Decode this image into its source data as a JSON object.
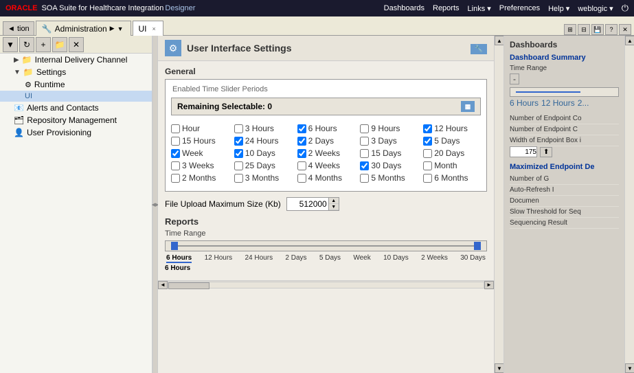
{
  "app": {
    "oracle_label": "ORACLE",
    "product_title": "SOA Suite for Healthcare Integration",
    "designer_label": "Designer"
  },
  "top_nav": {
    "items": [
      "Dashboards",
      "Reports",
      "Links ▾",
      "Preferences",
      "Help ▾",
      "weblogic ▾"
    ]
  },
  "tabs": {
    "back_label": "◄ tion",
    "admin_tab": {
      "label": "Administration",
      "icon": "🔧"
    },
    "ui_tab": {
      "label": "UI",
      "close": "×"
    }
  },
  "toolbar": {
    "buttons": [
      "▼",
      "☰",
      "+",
      "📁",
      "✕"
    ]
  },
  "sidebar": {
    "items": [
      {
        "label": "Internal Delivery Channel",
        "indent": 1,
        "type": "folder",
        "expanded": false
      },
      {
        "label": "Settings",
        "indent": 1,
        "type": "folder",
        "expanded": true
      },
      {
        "label": "Runtime",
        "indent": 2,
        "type": "node"
      },
      {
        "label": "UI",
        "indent": 2,
        "type": "node",
        "selected": true
      },
      {
        "label": "Alerts and Contacts",
        "indent": 1,
        "type": "node"
      },
      {
        "label": "Repository Management",
        "indent": 1,
        "type": "node"
      },
      {
        "label": "User Provisioning",
        "indent": 1,
        "type": "node"
      }
    ]
  },
  "content": {
    "page_title": "User Interface Settings",
    "section_general": "General",
    "time_slider_label": "Enabled Time Slider Periods",
    "remaining_label": "Remaining Selectable: 0",
    "checkboxes": [
      {
        "label": "Hour",
        "checked": false
      },
      {
        "label": "3 Hours",
        "checked": false
      },
      {
        "label": "6 Hours",
        "checked": true
      },
      {
        "label": "9 Hours",
        "checked": false
      },
      {
        "label": "12 Hours",
        "checked": true
      },
      {
        "label": "15 Hours",
        "checked": false
      },
      {
        "label": "24 Hours",
        "checked": true
      },
      {
        "label": "2 Days",
        "checked": true
      },
      {
        "label": "3 Days",
        "checked": false
      },
      {
        "label": "5 Days",
        "checked": true
      },
      {
        "label": "Week",
        "checked": true
      },
      {
        "label": "10 Days",
        "checked": true
      },
      {
        "label": "2 Weeks",
        "checked": true
      },
      {
        "label": "15 Days",
        "checked": false
      },
      {
        "label": "20 Days",
        "checked": false
      },
      {
        "label": "3 Weeks",
        "checked": false
      },
      {
        "label": "25 Days",
        "checked": false
      },
      {
        "label": "4 Weeks",
        "checked": false
      },
      {
        "label": "30 Days",
        "checked": true
      },
      {
        "label": "Month",
        "checked": false
      },
      {
        "label": "2 Months",
        "checked": false
      },
      {
        "label": "3 Months",
        "checked": false
      },
      {
        "label": "4 Months",
        "checked": false
      },
      {
        "label": "5 Months",
        "checked": false
      },
      {
        "label": "6 Months",
        "checked": false
      }
    ],
    "file_upload_label": "File Upload Maximum Size (Kb)",
    "file_upload_value": "512000",
    "reports_title": "Reports",
    "time_range_label": "Time Range",
    "time_labels": [
      "6 Hours",
      "12 Hours",
      "24 Hours",
      "2 Days",
      "5 Days",
      "Week",
      "10 Days",
      "2 Weeks",
      "30 Days"
    ],
    "selected_time": "6 Hours"
  },
  "right_panel": {
    "title": "Dashboards",
    "subsection": "Dashboard Summary",
    "time_range_label": "Time Range",
    "dash_btn": "-",
    "time_labels_small": [
      "6 Hours",
      "12 Hours",
      "2..."
    ],
    "rows": [
      {
        "label": "Number of Endpoint Co"
      },
      {
        "label": "Number of Endpoint C"
      },
      {
        "label": "Width of Endpoint Box i"
      }
    ],
    "width_value": "175",
    "maximized_title": "Maximized Endpoint De",
    "maximized_rows": [
      {
        "label": "Number of G"
      },
      {
        "label": "Auto-Refresh I"
      },
      {
        "label": "Documen"
      },
      {
        "label": "Slow Threshold for Seq"
      },
      {
        "label": "Sequencing Result"
      }
    ]
  }
}
